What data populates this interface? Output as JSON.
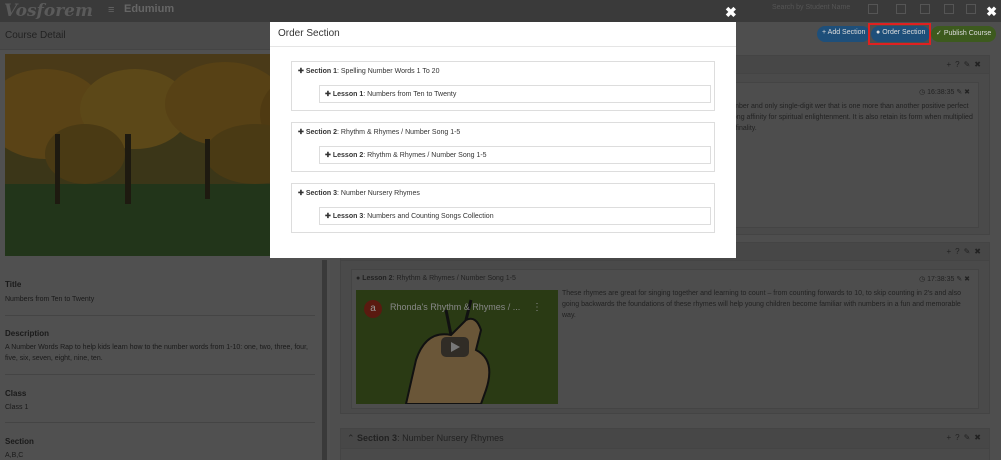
{
  "topnav": {
    "logo": "Vosforem",
    "app_title": "Edumium",
    "search_placeholder": "Search by Student Name"
  },
  "left_panel": {
    "title": "Course Detail",
    "fields": [
      {
        "label": "Title",
        "value": "Numbers from Ten to Twenty"
      },
      {
        "label": "Description",
        "value": "A Number Words Rap to help kids learn how to the number words from 1-10: one, two, three, four, five, six, seven, eight, nine, ten."
      },
      {
        "label": "Class",
        "value": "Class 1"
      },
      {
        "label": "Section",
        "value": "A,B,C"
      }
    ]
  },
  "toolbar": {
    "add_section": "Add Section",
    "order_section": "Order Section",
    "publish_course": "Publish Course"
  },
  "sections_bg": {
    "lesson1_time": "16:38:35",
    "lesson1_text": "r number, along with the first composite odd number and only single-digit wer that is one more than another positive perfect power, by Mihăilescu's gth established in its strong affinity for spiritual enlightenment. It is also retain its form when multiplied or reduced by another number. ... Number ol of finality.",
    "lesson2_prefix": "Lesson 2",
    "lesson2_title": "Rhythm & Rhymes / Number Song 1-5",
    "lesson2_time": "17:38:35",
    "lesson2_text": "These rhymes are great for singing together and learning to count – from counting forwards to 10, to skip counting in 2's and also going backwards the foundations of these rhymes will help young children become familiar with numbers in a fun and memorable way.",
    "video_title": "Rhonda's Rhythm & Rhymes / ...",
    "video_avatar": "a",
    "section3_prefix": "Section 3",
    "section3_title": "Number Nursery Rhymes"
  },
  "modal": {
    "title": "Order Section",
    "sections": [
      {
        "prefix": "Section 1",
        "title": "Spelling Number Words 1 To 20",
        "lesson_prefix": "Lesson 1",
        "lesson_title": "Numbers from Ten to Twenty"
      },
      {
        "prefix": "Section 2",
        "title": "Rhythm & Rhymes / Number Song 1-5",
        "lesson_prefix": "Lesson 2",
        "lesson_title": "Rhythm & Rhymes / Number Song 1-5"
      },
      {
        "prefix": "Section 3",
        "title": "Number Nursery Rhymes",
        "lesson_prefix": "Lesson 3",
        "lesson_title": "Numbers and Counting Songs Collection"
      }
    ]
  },
  "colors": {
    "add_button": "#337ab7",
    "publish_button": "#5cb85c",
    "highlight_box": "#e02020",
    "modal_bg": "#ffffff"
  }
}
